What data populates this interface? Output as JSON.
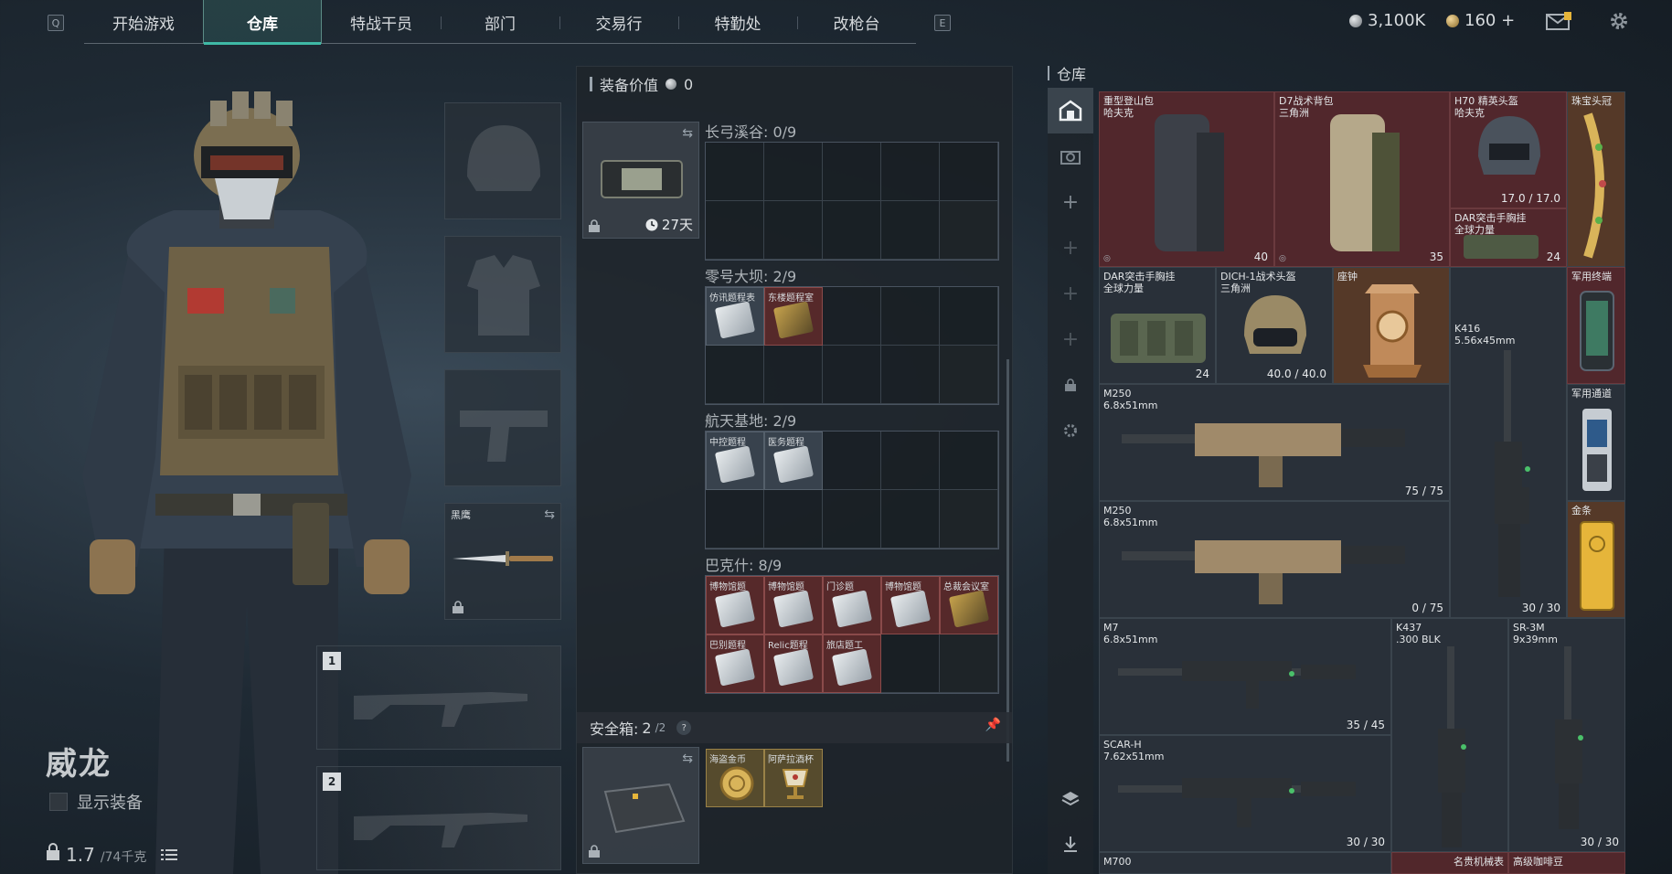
{
  "nav": {
    "left_key": "Q",
    "right_key": "E",
    "tabs": [
      {
        "label": "开始游戏"
      },
      {
        "label": "仓库",
        "active": true
      },
      {
        "label": "特战干员"
      },
      {
        "label": "部门"
      },
      {
        "label": "交易行"
      },
      {
        "label": "特勤处"
      },
      {
        "label": "改枪台"
      }
    ],
    "currency_silver": "3,100K",
    "currency_coin": "160 +",
    "accent_color": "#3fb9a6"
  },
  "character": {
    "name": "威龙",
    "show_equipment_label": "显示装备",
    "weight_current": "1.7",
    "weight_max": "/74千克"
  },
  "gear": {
    "melee_label": "黑鹰",
    "weapon_slot_1": "1",
    "weapon_slot_2": "2"
  },
  "backpack": {
    "equip_value_label": "装备价值",
    "equip_value": "0",
    "pouch_days": "27天",
    "sections": [
      {
        "label": "长弓溪谷: 0/9",
        "items": []
      },
      {
        "label": "零号大坝: 2/9",
        "items": [
          "仿讯题程表",
          "东楼题程室"
        ]
      },
      {
        "label": "航天基地: 2/9",
        "items": [
          "中控题程",
          "医务题程"
        ]
      },
      {
        "label": "巴克什: 8/9",
        "items": [
          "博物馆题",
          "博物馆题",
          "门诊题",
          "博物馆题",
          "总裁会议室",
          "巴别题程",
          "Relic题程",
          "旅店题工"
        ]
      }
    ],
    "safebox_label": "安全箱: ",
    "safebox_value": "2",
    "safebox_max": "/2",
    "safebox_help": "?",
    "safebox_items": [
      "海盗金币",
      "阿萨拉酒杯"
    ]
  },
  "warehouse": {
    "title": "仓库",
    "items": [
      {
        "name": "重型登山包\n哈夫克",
        "count": "40"
      },
      {
        "name": "D7战术背包\n三角洲",
        "count": "35"
      },
      {
        "name": "H70 精英头盔\n哈夫克",
        "count": "17.0 / 17.0"
      },
      {
        "name": "珠宝头冠",
        "count": ""
      },
      {
        "name": "DAR突击手胸挂\n全球力量",
        "count": "24"
      },
      {
        "name": "DAR突击手胸挂\n全球力量",
        "count": "24"
      },
      {
        "name": "DICH-1战术头盔\n三角洲",
        "count": "40.0 / 40.0"
      },
      {
        "name": "座钟",
        "count": ""
      },
      {
        "name": "军用终端",
        "count": ""
      },
      {
        "name": "K416\n5.56x45mm",
        "count": "30 / 30"
      },
      {
        "name": "M250\n6.8x51mm",
        "count": "75 / 75"
      },
      {
        "name": "军用通道",
        "count": ""
      },
      {
        "name": "M250\n6.8x51mm",
        "count": "0 / 75"
      },
      {
        "name": "金条",
        "count": ""
      },
      {
        "name": "M7\n6.8x51mm",
        "count": "35 / 45"
      },
      {
        "name": "K437\n.300 BLK",
        "count": ""
      },
      {
        "name": "SR-3M\n9x39mm",
        "count": "30 / 30"
      },
      {
        "name": "SCAR-H\n7.62x51mm",
        "count": "30 / 30"
      },
      {
        "name": "M700",
        "count": ""
      },
      {
        "name": "名贵机械表",
        "count": ""
      },
      {
        "name": "高级咖啡豆",
        "count": ""
      }
    ]
  }
}
